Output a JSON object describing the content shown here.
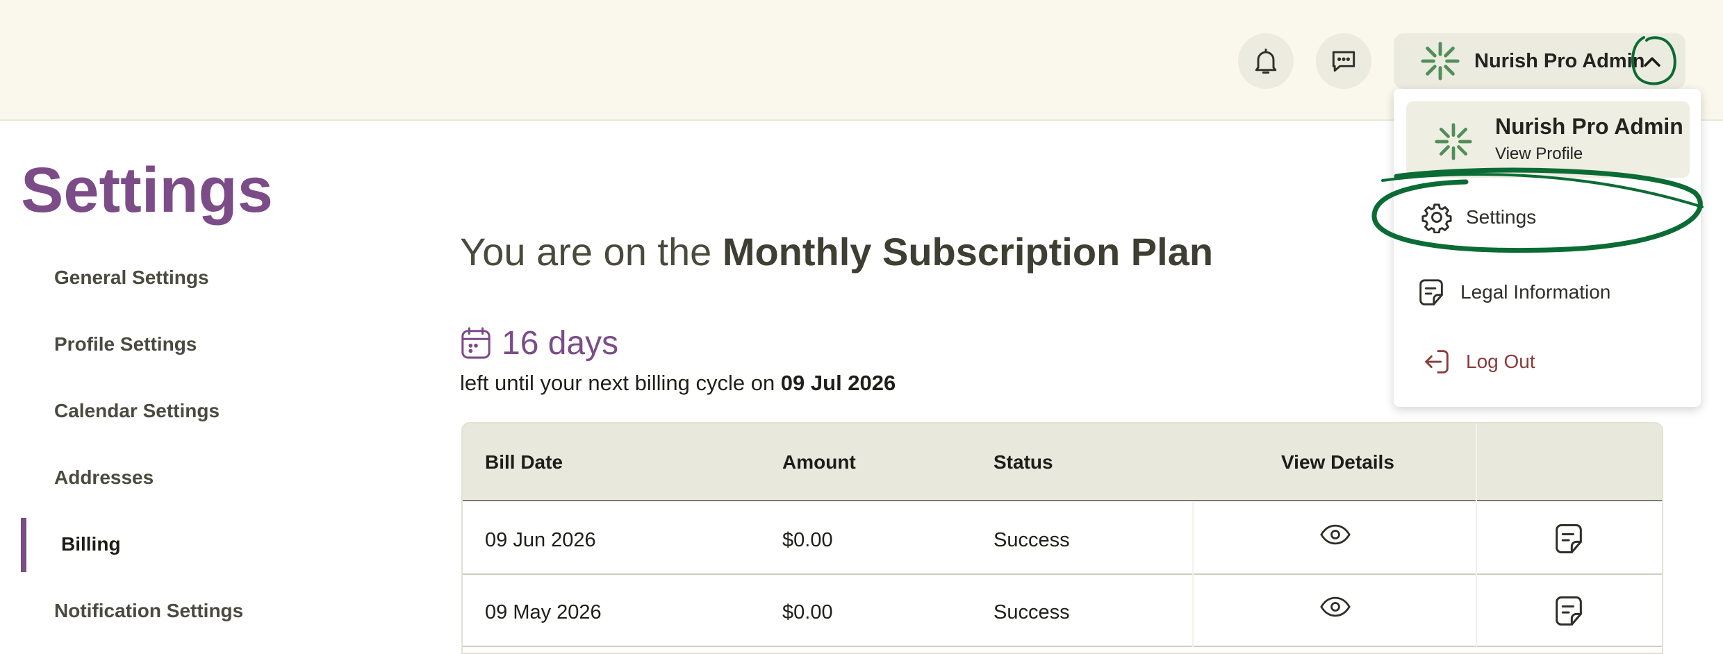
{
  "header": {
    "account_name": "Nurish Pro Admin",
    "icons": [
      "bell-icon",
      "chat-icon",
      "brand-logo-icon",
      "chevron-up-icon"
    ]
  },
  "dropdown": {
    "profile_name": "Nurish Pro Admin",
    "profile_sub": "View Profile",
    "settings_label": "Settings",
    "legal_label": "Legal Information",
    "logout_label": "Log Out"
  },
  "sidebar": {
    "title": "Settings",
    "items": [
      {
        "label": "General Settings"
      },
      {
        "label": "Profile Settings"
      },
      {
        "label": "Calendar Settings"
      },
      {
        "label": "Addresses"
      },
      {
        "label": "Billing"
      },
      {
        "label": "Notification Settings"
      }
    ],
    "active_index": 4
  },
  "main": {
    "plan_prefix": "You are on the ",
    "plan_name": "Monthly Subscription Plan",
    "days_left": "16 days",
    "billing_text": "left until your next billing cycle on ",
    "billing_date": "09 Jul 2026"
  },
  "table": {
    "headers": [
      "Bill Date",
      "Amount",
      "Status",
      "View Details"
    ],
    "rows": [
      {
        "date": "09 Jun 2026",
        "amount": "$0.00",
        "status": "Success"
      },
      {
        "date": "09 May 2026",
        "amount": "$0.00",
        "status": "Success"
      }
    ]
  },
  "colors": {
    "brand_purple": "#7b4c87",
    "brand_green": "#4f8f5a",
    "annotation_green": "#0b6b34",
    "logout_red": "#8a3b3b"
  }
}
